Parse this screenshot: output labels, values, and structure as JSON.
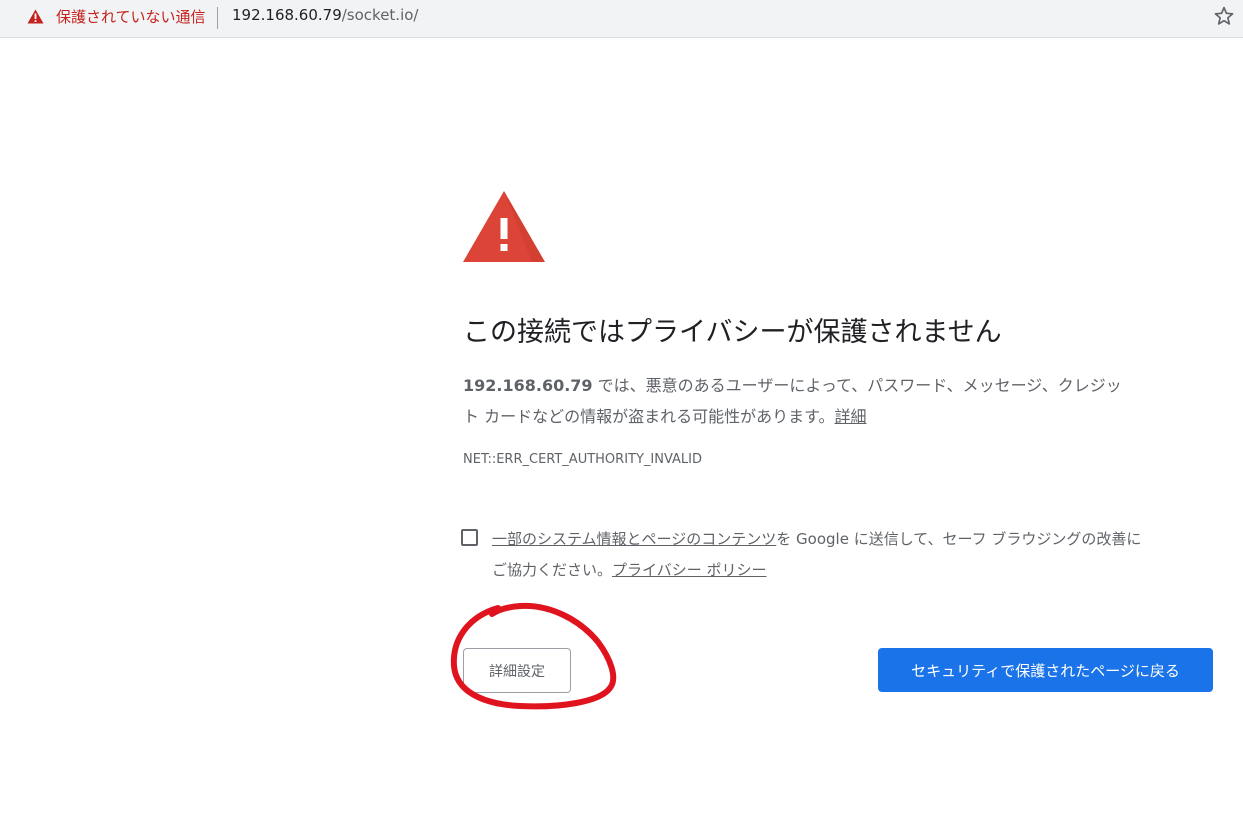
{
  "omnibox": {
    "security_label": "保護されていない通信",
    "url_host": "192.168.60.79",
    "url_path": "/socket.io/",
    "warning_icon": "warning-triangle-icon",
    "bookmark_icon": "star-icon"
  },
  "interstitial": {
    "icon": "warning-triangle-icon",
    "heading": "この接続ではプライバシーが保護されません",
    "host_bold": "192.168.60.79",
    "message_line1_rest": " では、悪意のあるユーザーによって、パスワード、メッセージ、クレジッ",
    "message_line2": "ト カードなどの情報が盗まれる可能性があります。",
    "learn_more_link": "詳細",
    "error_code": "NET::ERR_CERT_AUTHORITY_INVALID",
    "safe_browsing": {
      "link_text": "一部のシステム情報とページのコンテンツ",
      "line1_rest": "を Google に送信して、セーフ ブラウジングの改善に",
      "line2_text": "ご協力ください。",
      "privacy_link": "プライバシー ポリシー"
    },
    "details_button_label": "詳細設定",
    "back_button_label": "セキュリティで保護されたページに戻る"
  },
  "colors": {
    "warning_red": "#db4437",
    "security_text_red": "#c5221f",
    "primary_blue": "#1a73e8",
    "annotation_red": "#e0141e"
  }
}
